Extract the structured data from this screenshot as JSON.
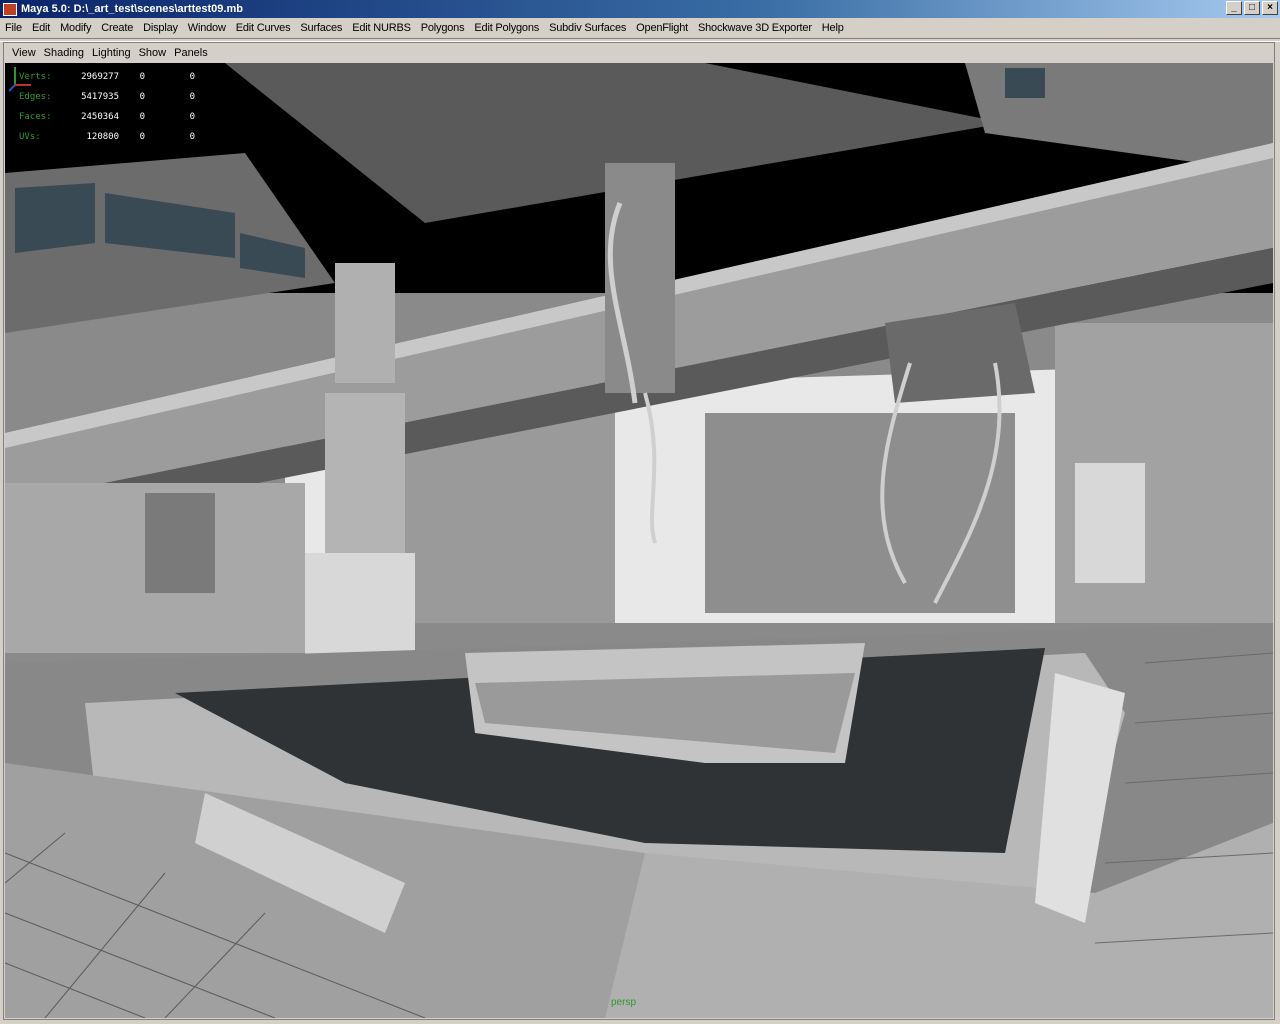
{
  "window": {
    "title": "Maya 5.0: D:\\_art_test\\scenes\\arttest09.mb",
    "min": "_",
    "max": "□",
    "close": "×"
  },
  "menu": [
    "File",
    "Edit",
    "Modify",
    "Create",
    "Display",
    "Window",
    "Edit Curves",
    "Surfaces",
    "Edit NURBS",
    "Polygons",
    "Edit Polygons",
    "Subdiv Surfaces",
    "OpenFlight",
    "Shockwave 3D Exporter",
    "Help"
  ],
  "panel_menu": [
    "View",
    "Shading",
    "Lighting",
    "Show",
    "Panels"
  ],
  "hud": [
    {
      "label": "Verts:",
      "value": "2969277",
      "z1": "0",
      "z2": "0"
    },
    {
      "label": "Edges:",
      "value": "5417935",
      "z1": "0",
      "z2": "0"
    },
    {
      "label": "Faces:",
      "value": "2450364",
      "z1": "0",
      "z2": "0"
    },
    {
      "label": "UVs:",
      "value": "120800",
      "z1": "0",
      "z2": "0"
    }
  ],
  "camera": "persp",
  "colors": {
    "hud_label": "#2e9a2e",
    "background": "#000000"
  }
}
